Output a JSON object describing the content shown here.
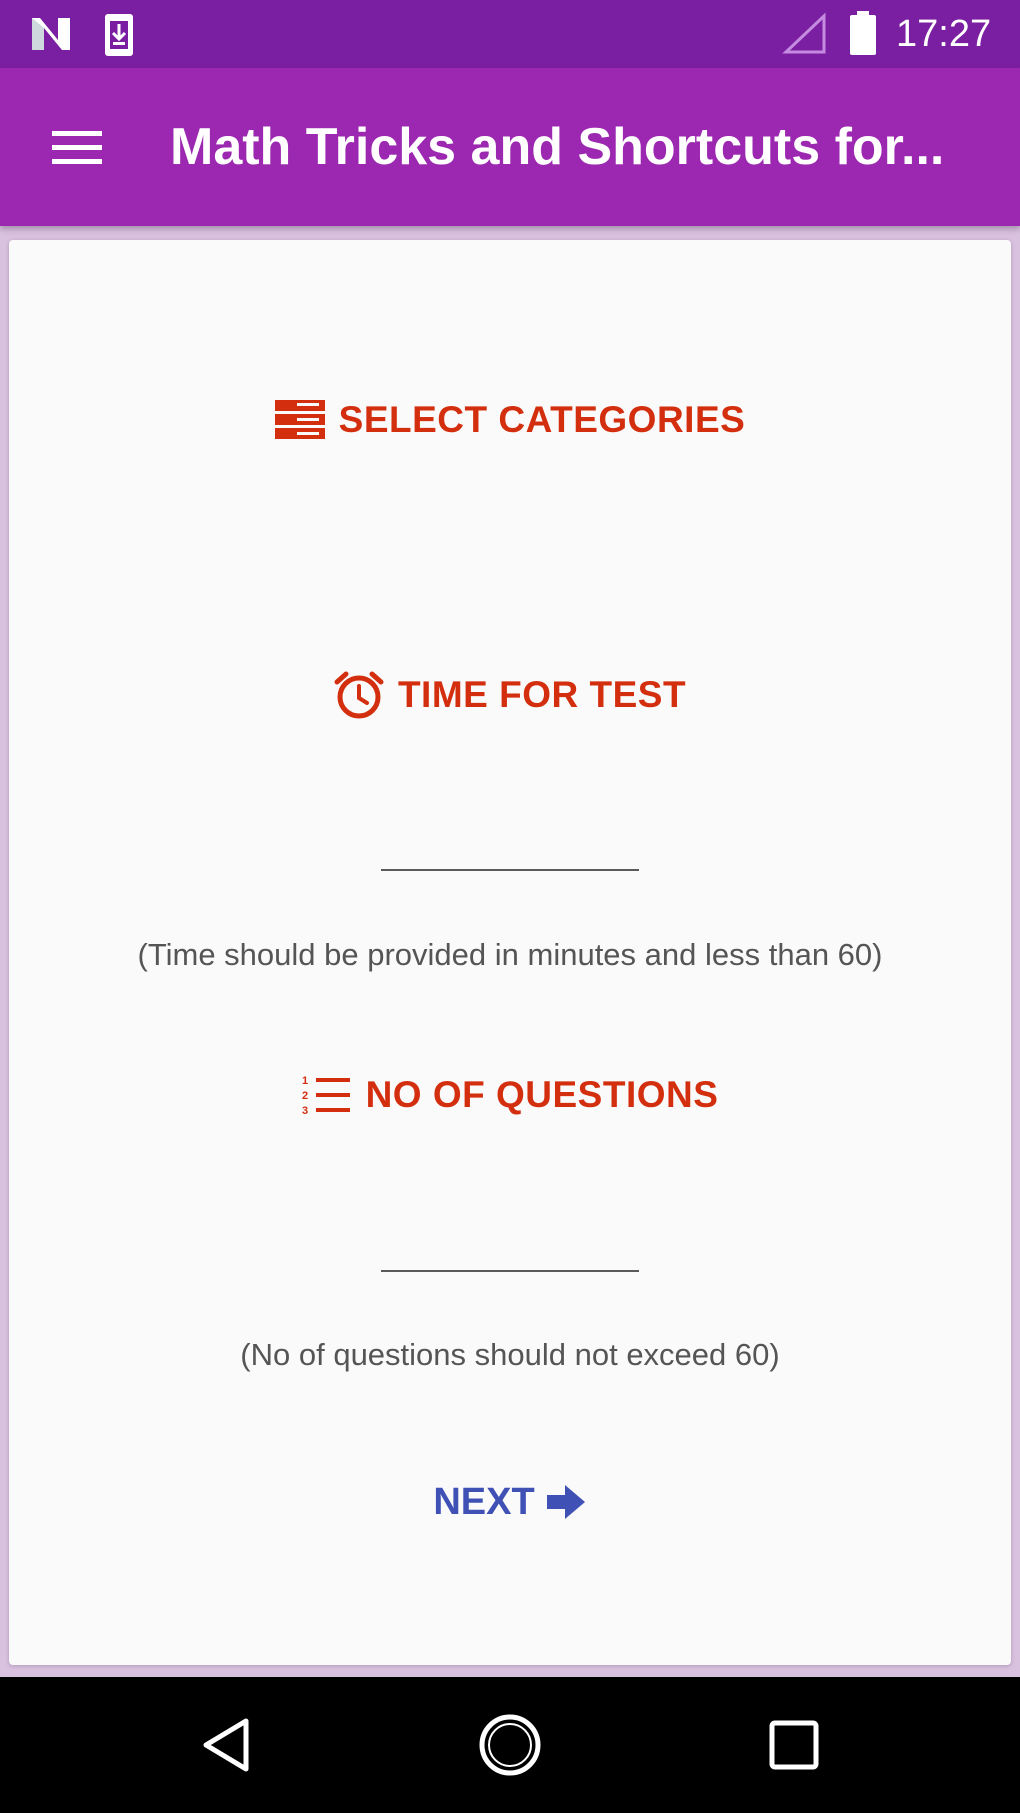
{
  "status_bar": {
    "time": "17:27",
    "icons": [
      "n-notification-icon",
      "download-icon",
      "signal-icon",
      "battery-icon"
    ]
  },
  "app_bar": {
    "title": "Math Tricks and Shortcuts for...",
    "menu_icon": "hamburger-menu-icon"
  },
  "content": {
    "select_categories_label": "SELECT CATEGORIES",
    "time_for_test_label": "TIME FOR TEST",
    "time_input_value": "",
    "time_hint": "(Time should be provided in minutes and less than 60)",
    "no_of_questions_label": "NO OF QUESTIONS",
    "questions_input_value": "",
    "questions_hint": "(No of questions should not exceed 60)",
    "next_label": "NEXT"
  },
  "nav_bar": {
    "icons": [
      "back-icon",
      "home-icon",
      "recents-icon"
    ]
  },
  "colors": {
    "status_bar": "#7b1fa2",
    "app_bar": "#9c27b0",
    "accent": "#d32f0f",
    "next": "#3f51b5"
  }
}
